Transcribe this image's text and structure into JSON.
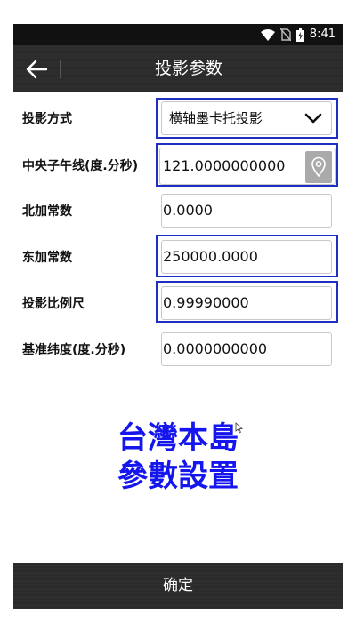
{
  "status_bar": {
    "time": "8:41",
    "icons": [
      "wifi-icon",
      "no-sim-icon",
      "battery-charging-icon"
    ]
  },
  "header": {
    "back_icon": "arrow-left-icon",
    "title": "投影参数"
  },
  "form": {
    "projection_method": {
      "label": "投影方式",
      "value": "横轴墨卡托投影",
      "icon": "chevron-down-icon"
    },
    "central_meridian": {
      "label": "中央子午线(度.分秒)",
      "value": "121.0000000000",
      "icon": "location-pin-icon"
    },
    "false_northing": {
      "label": "北加常数",
      "value": "0.0000"
    },
    "false_easting": {
      "label": "东加常数",
      "value": "250000.0000"
    },
    "scale_factor": {
      "label": "投影比例尺",
      "value": "0.99990000"
    },
    "base_latitude": {
      "label": "基准纬度(度.分秒)",
      "value": "0.0000000000"
    }
  },
  "overlay": {
    "line1": "台灣本島",
    "line2": "參數設置",
    "color": "#1515ee"
  },
  "highlight_color": "#1f2fbf",
  "footer": {
    "confirm_label": "确定"
  }
}
